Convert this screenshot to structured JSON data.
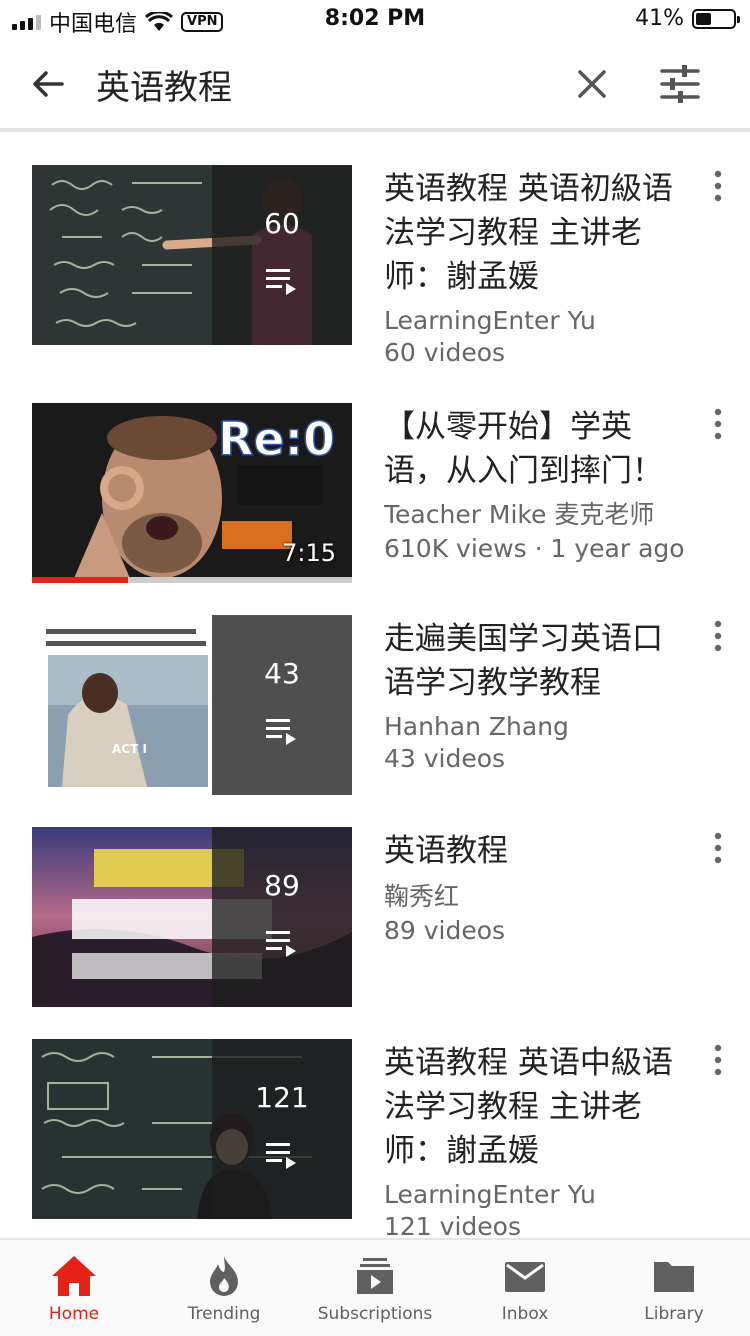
{
  "status_bar": {
    "carrier": "中国电信",
    "vpn": "VPN",
    "time": "8:02 PM",
    "battery": "41%",
    "battery_level": 0.41
  },
  "search": {
    "query": "英语教程",
    "back_icon": "arrow-back-icon",
    "clear_icon": "close-icon",
    "filter_icon": "tune-icon"
  },
  "results": [
    {
      "title": "英语教程 英语初級语法学习教程 主讲老师：謝孟媛",
      "channel": "LearningEnter Yu",
      "meta": "60 videos",
      "overlay_count": "60",
      "type": "playlist"
    },
    {
      "title": "【从零开始】学英语，从入门到摔门！",
      "channel": "Teacher Mike 麦克老师",
      "meta": "610K views · 1 year ago",
      "duration": "7:15",
      "thumb_text": "Re:0",
      "watch_progress": 0.3,
      "type": "video"
    },
    {
      "title": "走遍美国学习英语口语学习教学教程",
      "channel": "Hanhan Zhang",
      "meta": "43 videos",
      "overlay_count": "43",
      "type": "playlist"
    },
    {
      "title": "英语教程",
      "channel": "鞠秀红",
      "meta": "89 videos",
      "overlay_count": "89",
      "type": "playlist"
    },
    {
      "title": "英语教程 英语中級语法学习教程 主讲老师：謝孟媛",
      "channel": "LearningEnter Yu",
      "meta": "121 videos",
      "overlay_count": "121",
      "type": "playlist"
    }
  ],
  "bottom_nav": [
    {
      "label": "Home",
      "icon": "home-icon",
      "active": true
    },
    {
      "label": "Trending",
      "icon": "flame-icon",
      "active": false
    },
    {
      "label": "Subscriptions",
      "icon": "subscriptions-icon",
      "active": false
    },
    {
      "label": "Inbox",
      "icon": "mail-icon",
      "active": false
    },
    {
      "label": "Library",
      "icon": "folder-icon",
      "active": false
    }
  ],
  "colors": {
    "accent": "#e62117",
    "text_primary": "#222222",
    "text_secondary": "#666666"
  }
}
